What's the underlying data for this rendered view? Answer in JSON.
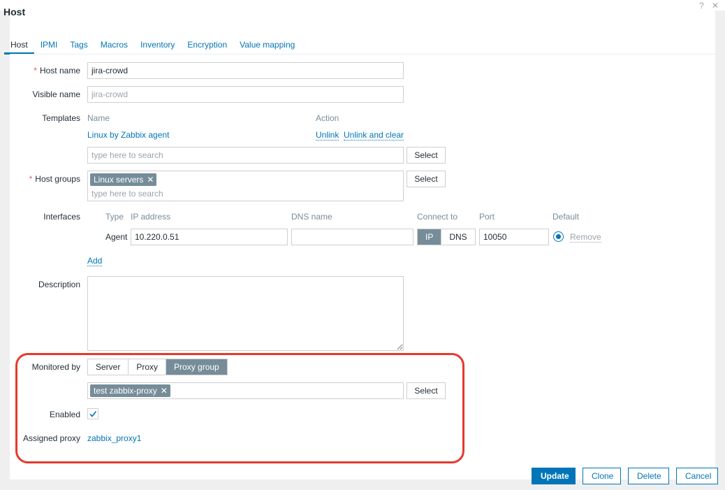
{
  "dialog": {
    "title": "Host",
    "help_glyph": "?",
    "close_glyph": "✕"
  },
  "tabs": [
    {
      "label": "Host",
      "active": true
    },
    {
      "label": "IPMI"
    },
    {
      "label": "Tags"
    },
    {
      "label": "Macros"
    },
    {
      "label": "Inventory"
    },
    {
      "label": "Encryption"
    },
    {
      "label": "Value mapping"
    }
  ],
  "form": {
    "host_name": {
      "label": "Host name",
      "required_mark": "*",
      "value": "jira-crowd"
    },
    "visible_name": {
      "label": "Visible name",
      "placeholder": "jira-crowd"
    },
    "templates": {
      "label": "Templates",
      "col_name": "Name",
      "col_action": "Action",
      "linked": "Linux by Zabbix agent",
      "unlink": "Unlink",
      "unlink_clear": "Unlink and clear",
      "search_placeholder": "type here to search",
      "select": "Select"
    },
    "host_groups": {
      "label": "Host groups",
      "required_mark": "*",
      "chip": "Linux servers",
      "search_placeholder": "type here to search",
      "select": "Select"
    },
    "interfaces": {
      "label": "Interfaces",
      "col_type": "Type",
      "col_ip": "IP address",
      "col_dns": "DNS name",
      "col_connect": "Connect to",
      "col_port": "Port",
      "col_default": "Default",
      "type": "Agent",
      "ip": "10.220.0.51",
      "dns": "",
      "connect_ip": "IP",
      "connect_dns": "DNS",
      "port": "10050",
      "remove": "Remove",
      "add": "Add"
    },
    "description": {
      "label": "Description",
      "value": ""
    },
    "monitored_by": {
      "label": "Monitored by",
      "options": [
        "Server",
        "Proxy",
        "Proxy group"
      ],
      "selected": "Proxy group",
      "chip": "test zabbix-proxy",
      "select": "Select"
    },
    "enabled": {
      "label": "Enabled",
      "checked": true
    },
    "assigned_proxy": {
      "label": "Assigned proxy",
      "value": "zabbix_proxy1"
    }
  },
  "footer": {
    "update": "Update",
    "clone": "Clone",
    "delete": "Delete",
    "cancel": "Cancel"
  },
  "colors": {
    "accent": "#0275b8",
    "highlight": "#e53a2d",
    "chip": "#768d99"
  },
  "icons": {
    "chip_remove": "✕",
    "checkmark": "check-icon"
  }
}
